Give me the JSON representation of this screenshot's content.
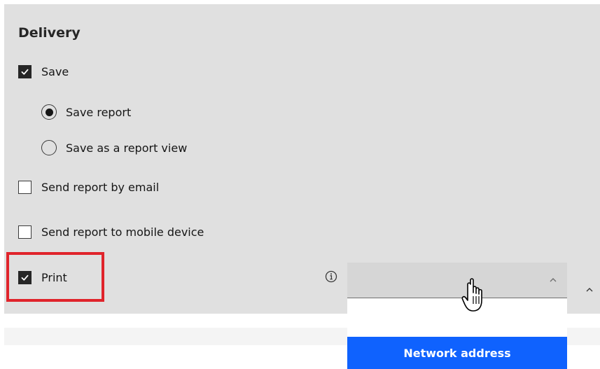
{
  "delivery": {
    "heading": "Delivery",
    "save": {
      "label": "Save",
      "checked": true
    },
    "save_options": [
      {
        "label": "Save report",
        "selected": true
      },
      {
        "label": "Save as a report view",
        "selected": false
      }
    ],
    "email": {
      "label": "Send report by email",
      "checked": false
    },
    "mobile": {
      "label": "Send report to mobile device",
      "checked": false
    },
    "print": {
      "label": "Print",
      "checked": true
    }
  },
  "printer_select": {
    "info_icon": "info-icon",
    "chevron_icon": "chevron-up-icon",
    "menu_items": [
      {
        "label": "Network address"
      }
    ]
  },
  "colors": {
    "panel": "#e0e0e0",
    "highlight": "#e0242b",
    "menu_selected": "#0f62fe"
  }
}
